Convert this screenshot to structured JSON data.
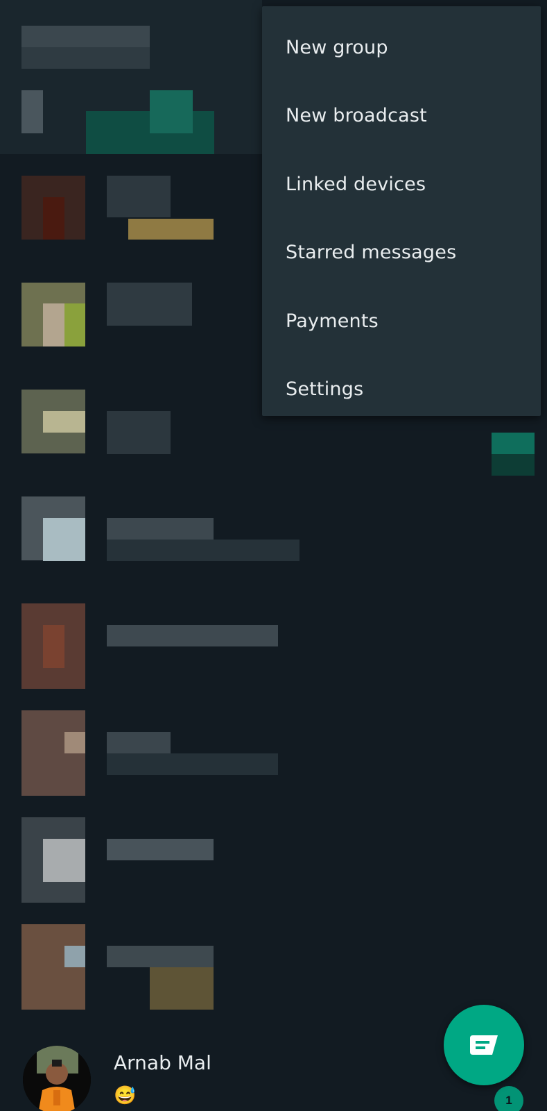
{
  "menu": {
    "items": [
      {
        "label": "New group"
      },
      {
        "label": "New broadcast"
      },
      {
        "label": "Linked devices"
      },
      {
        "label": "Starred messages"
      },
      {
        "label": "Payments"
      },
      {
        "label": "Settings"
      }
    ]
  },
  "chat": {
    "name": "Arnab Mal",
    "preview_emoji": "😅",
    "unread_count": "1"
  },
  "fab": {
    "icon": "new-chat-icon"
  },
  "colors": {
    "background": "#121b22",
    "menu_bg": "#233138",
    "accent": "#00a884",
    "text": "#e9edef"
  }
}
